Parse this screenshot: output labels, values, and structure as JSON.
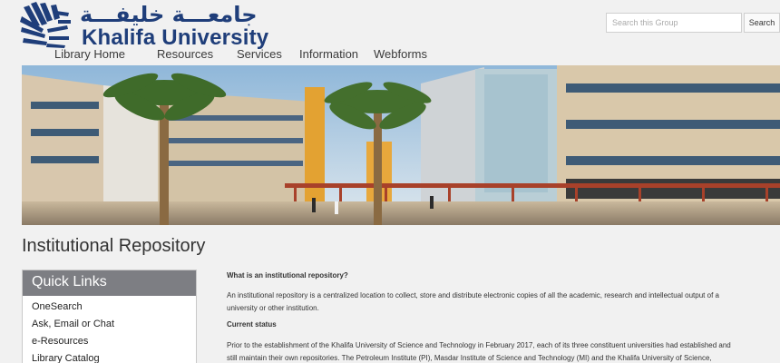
{
  "header": {
    "logo_arabic": "جامعـــة خليفـــة",
    "logo_english": "Khalifa University",
    "brand_color": "#1f3e7a"
  },
  "nav": {
    "items": [
      "Library Home",
      "Resources",
      "Services",
      "Information",
      "Webforms"
    ]
  },
  "search": {
    "placeholder": "Search this Group",
    "button_label": "Search"
  },
  "banner": {
    "icon": "campus-photo"
  },
  "page": {
    "title": "Institutional Repository"
  },
  "quick_links": {
    "title": "Quick Links",
    "items": [
      "OneSearch",
      "Ask, Email or Chat",
      "e-Resources",
      "Library Catalog"
    ]
  },
  "content": {
    "heading1": "What is an institutional repository?",
    "para1_line1": "An institutional repository is a centralized location to collect, store and distribute electronic copies of all the academic, research and intellectual output of a",
    "para1_line2": "university or other institution.",
    "heading2": "Current status",
    "para2_line1": "Prior to the establishment of the Khalifa University of Science and Technology in February 2017, each of its three constituent universities had established and",
    "para2_line2": "still maintain their own repositories. The Petroleum Institute (PI), Masdar Institute of Science and Technology (MI) and the Khalifa University of Science,"
  }
}
